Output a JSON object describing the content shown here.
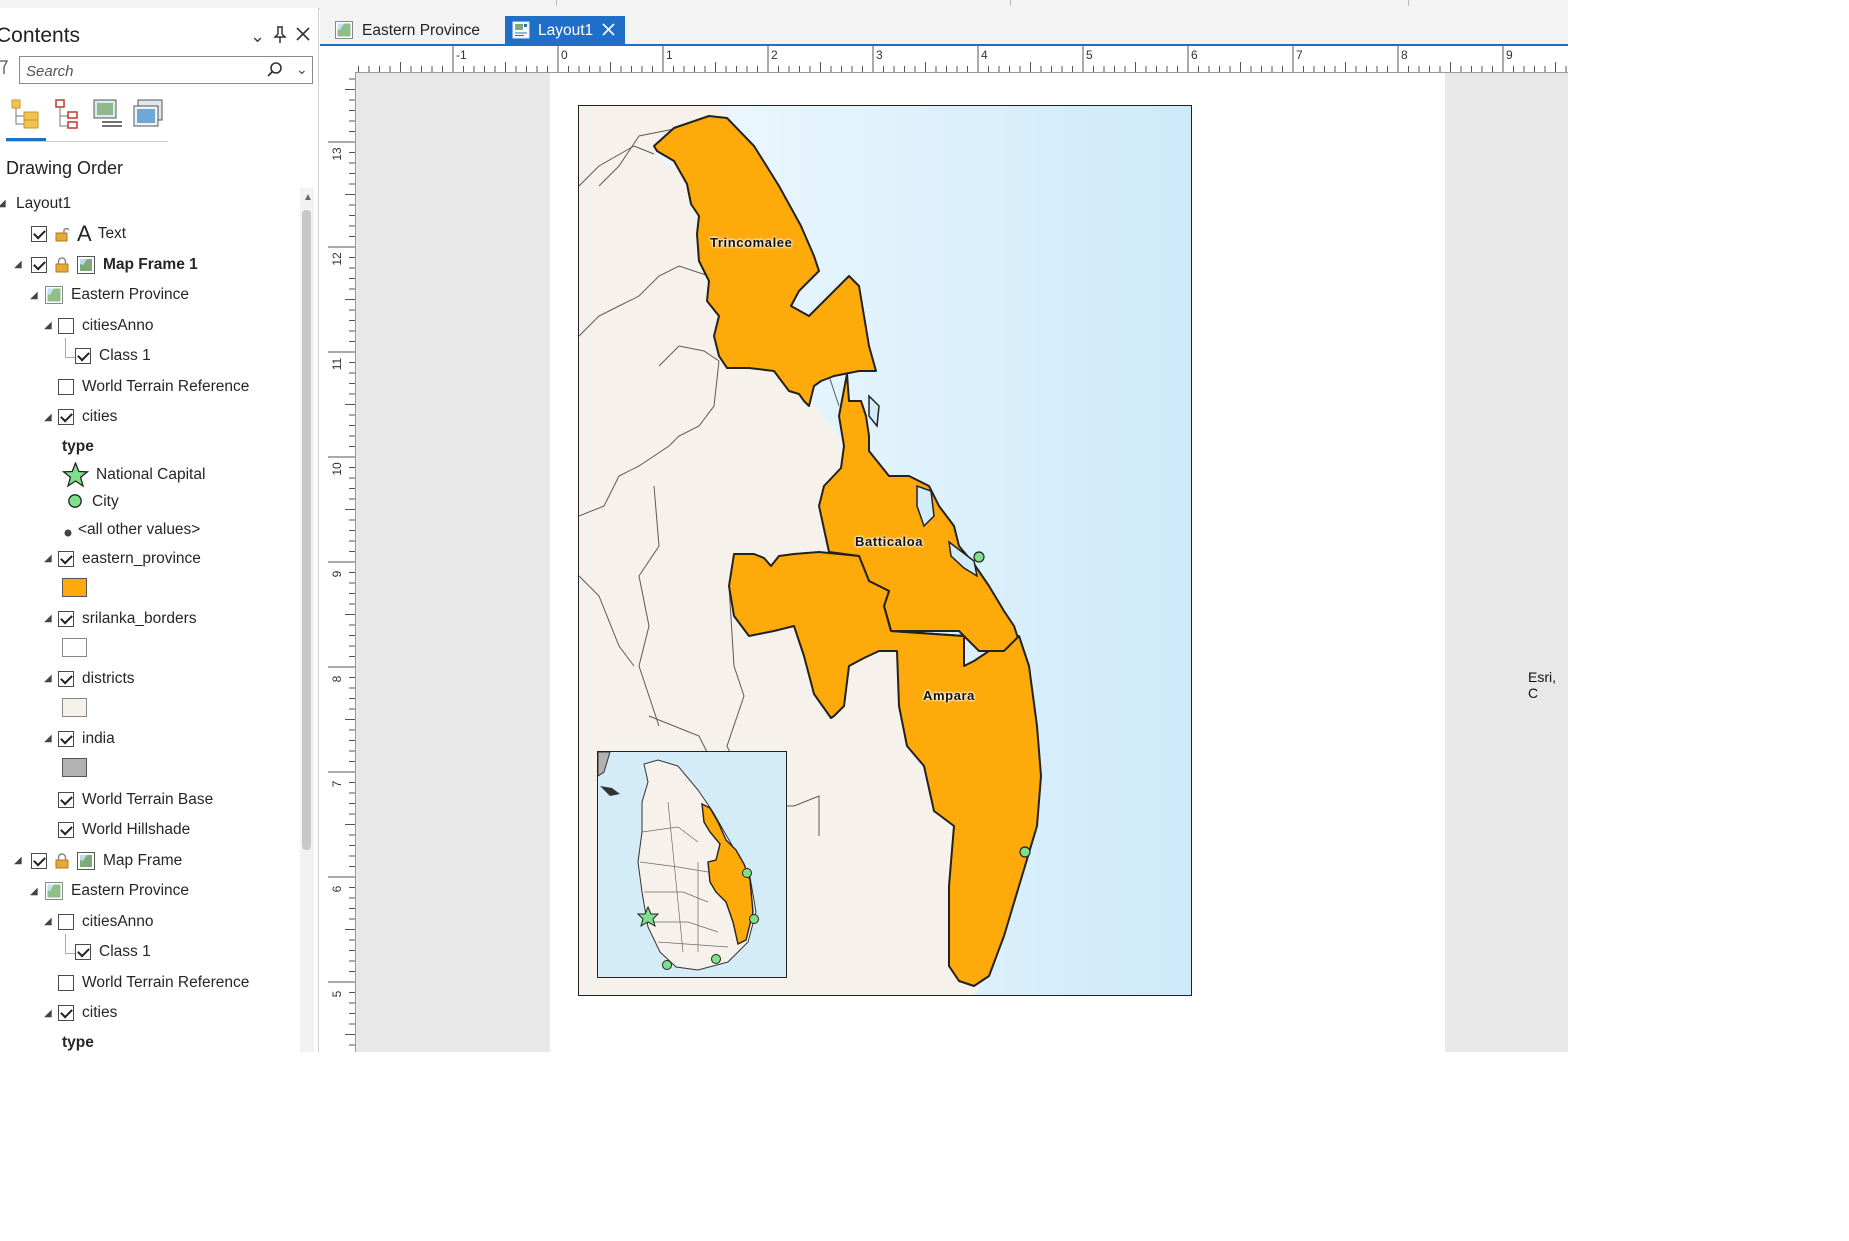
{
  "pane": {
    "title": "Contents",
    "search_placeholder": "Search",
    "section_title": "Drawing Order"
  },
  "tabs": [
    {
      "label": "Eastern Province",
      "active": false
    },
    {
      "label": "Layout1",
      "active": true
    }
  ],
  "tree": {
    "root": "Layout1",
    "text_item": "Text",
    "frame1": {
      "name": "Map Frame 1",
      "map": "Eastern Province",
      "cities_anno": "citiesAnno",
      "class1": "Class 1",
      "terrain_ref": "World Terrain Reference",
      "cities": "cities",
      "type_heading": "type",
      "legend_national_capital": "National Capital",
      "legend_city": "City",
      "legend_other": "<all other values>",
      "eastern_province": "eastern_province",
      "srilanka_borders": "srilanka_borders",
      "districts": "districts",
      "india": "india",
      "terrain_base": "World Terrain Base",
      "hillshade": "World Hillshade"
    },
    "frame2": {
      "name": "Map Frame",
      "map": "Eastern Province",
      "cities_anno": "citiesAnno",
      "class1": "Class 1",
      "terrain_ref": "World Terrain Reference",
      "cities": "cities",
      "type_heading": "type"
    }
  },
  "ruler_h": [
    "-1",
    "0",
    "1",
    "2",
    "3",
    "4",
    "5",
    "6",
    "7",
    "8",
    "9"
  ],
  "ruler_v": [
    "13",
    "12",
    "11",
    "10",
    "9",
    "8",
    "7",
    "6",
    "5"
  ],
  "map": {
    "labels": {
      "trincomalee": "Trincomalee",
      "batticaloa": "Batticaloa",
      "ampara": "Ampara"
    },
    "credit": "Esri, C"
  },
  "colors": {
    "province_fill": "#fdaa0a",
    "land": "#f6f1eb",
    "water": "#d2ecfa",
    "city_point": "#7ee08a",
    "accent": "#1f6fc9",
    "india_fill": "#b2b2b2"
  }
}
